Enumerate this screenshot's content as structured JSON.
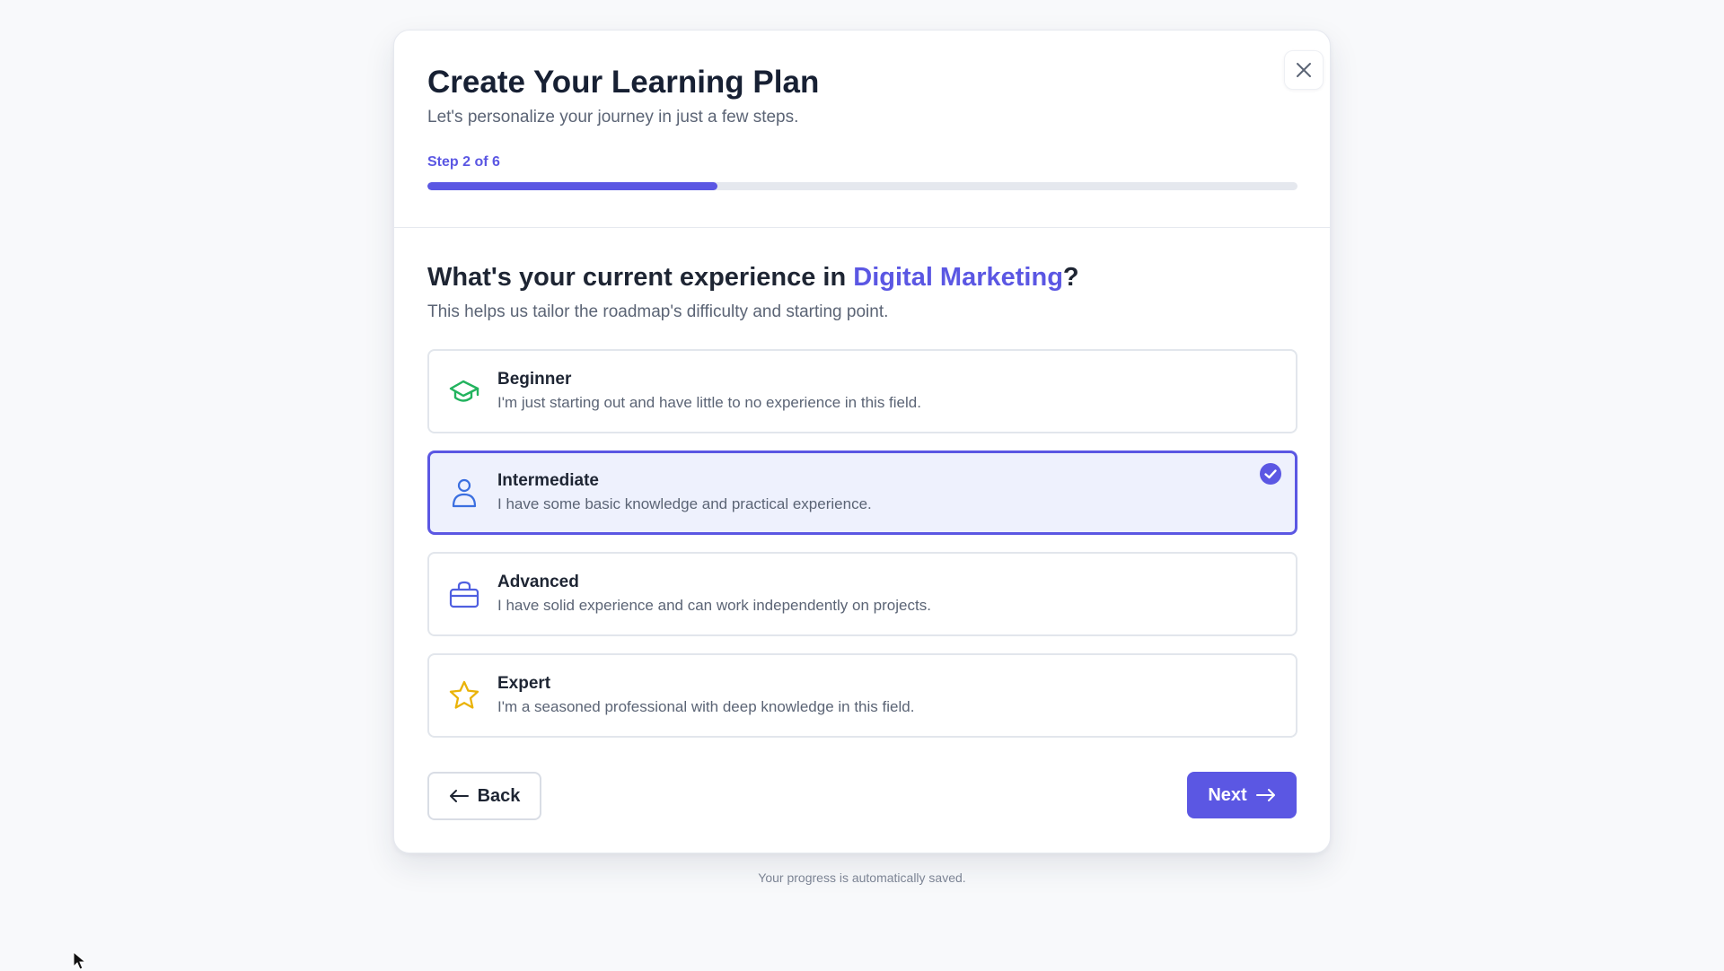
{
  "modal": {
    "title": "Create Your Learning Plan",
    "subtitle": "Let's personalize your journey in just a few steps.",
    "close_icon": "close-icon",
    "step": {
      "label": "Step 2 of 6",
      "current": 2,
      "total": 6,
      "progress_fraction": 0.333
    }
  },
  "question": {
    "prefix": "What's your current experience in ",
    "topic": "Digital Marketing",
    "suffix": "?",
    "help": "This helps us tailor the roadmap's difficulty and starting point."
  },
  "options": [
    {
      "title": "Beginner",
      "description": "I'm just starting out and have little to no experience in this field.",
      "icon": "graduation-cap-icon",
      "icon_color": "#22b35e",
      "selected": false
    },
    {
      "title": "Intermediate",
      "description": "I have some basic knowledge and practical experience.",
      "icon": "user-icon",
      "icon_color": "#3b6fe0",
      "selected": true
    },
    {
      "title": "Advanced",
      "description": "I have solid experience and can work independently on projects.",
      "icon": "briefcase-icon",
      "icon_color": "#4f5fe0",
      "selected": false
    },
    {
      "title": "Expert",
      "description": "I'm a seasoned professional with deep knowledge in this field.",
      "icon": "star-icon",
      "icon_color": "#eab308",
      "selected": false
    }
  ],
  "actions": {
    "back_label": "Back",
    "next_label": "Next"
  },
  "footer_note": "Your progress is automatically saved.",
  "colors": {
    "accent": "#5b57e3",
    "selected_bg": "#eef1fd",
    "page_bg": "#f8f9fb"
  }
}
